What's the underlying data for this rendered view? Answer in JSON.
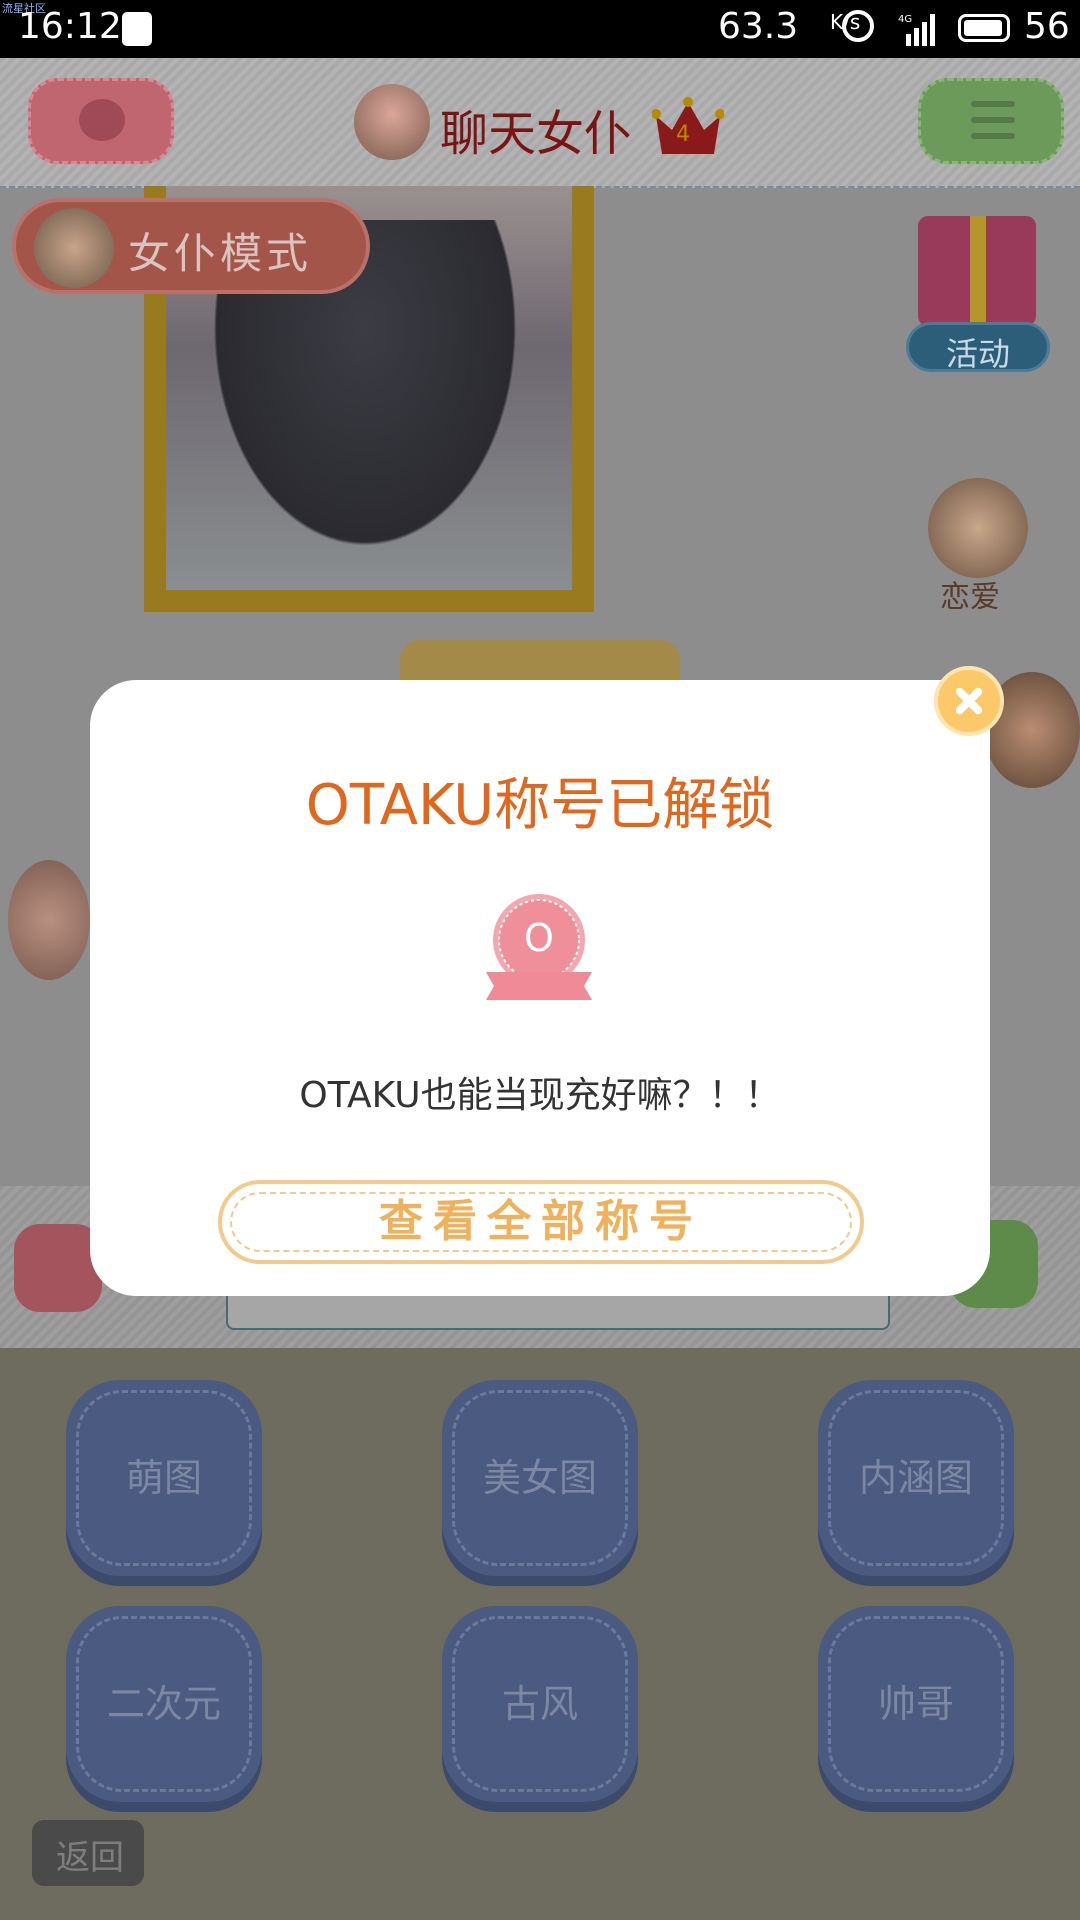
{
  "status_bar": {
    "watermark": "流星社区",
    "time": "16:12",
    "network_speed": "63.3",
    "speed_unit": "K/s",
    "network_type": "4G",
    "battery_level": "56"
  },
  "header": {
    "title": "聊天女仆",
    "crown_level": "4"
  },
  "main": {
    "mode_label": "女仆模式",
    "activity_label": "活动",
    "love_label": "恋爱"
  },
  "categories": [
    {
      "label": "萌图"
    },
    {
      "label": "美女图"
    },
    {
      "label": "内涵图"
    },
    {
      "label": "二次元"
    },
    {
      "label": "古风"
    },
    {
      "label": "帅哥"
    }
  ],
  "back_label": "返回",
  "dialog": {
    "title": "OTAKU称号已解锁",
    "badge_text": "O",
    "message": "OTAKU也能当现充好嘛？！！",
    "button_label": "查看全部称号"
  },
  "colors": {
    "dialog_title": "#e2661c",
    "button_text": "#f0b15a",
    "badge": "#f08a96"
  }
}
